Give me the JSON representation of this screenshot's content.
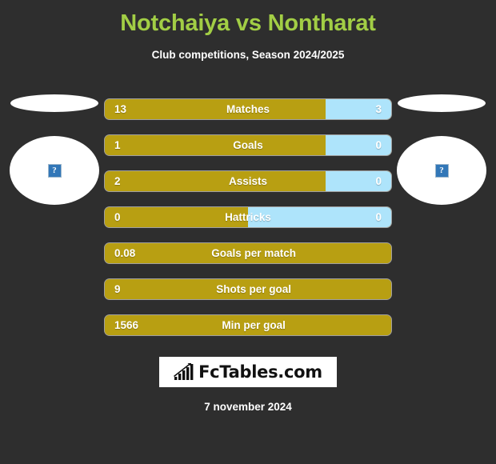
{
  "header": {
    "title": "Notchaiya vs Nontharat",
    "subtitle": "Club competitions, Season 2024/2025",
    "title_color": "#a2ce45"
  },
  "players": {
    "left": {
      "photo_alt_icon": "broken-image-icon",
      "placeholder_glyph": "?"
    },
    "right": {
      "photo_alt_icon": "broken-image-icon",
      "placeholder_glyph": "?"
    }
  },
  "colors": {
    "background": "#2e2e2e",
    "bar_left": "#b89f12",
    "bar_right": "#aee4fb",
    "text": "#ffffff"
  },
  "chart_data": {
    "type": "bar",
    "title": "Notchaiya vs Nontharat",
    "subtitle": "Club competitions, Season 2024/2025",
    "orientation": "horizontal-diverging",
    "series": [
      {
        "name": "Notchaiya",
        "color": "#b89f12",
        "side": "left"
      },
      {
        "name": "Nontharat",
        "color": "#aee4fb",
        "side": "right"
      }
    ],
    "categories": [
      "Matches",
      "Goals",
      "Assists",
      "Hattricks",
      "Goals per match",
      "Shots per goal",
      "Min per goal"
    ],
    "rows": [
      {
        "label": "Matches",
        "left_value": "13",
        "right_value": "3",
        "left_pct": 77,
        "split": true
      },
      {
        "label": "Goals",
        "left_value": "1",
        "right_value": "0",
        "left_pct": 77,
        "split": true
      },
      {
        "label": "Assists",
        "left_value": "2",
        "right_value": "0",
        "left_pct": 77,
        "split": true
      },
      {
        "label": "Hattricks",
        "left_value": "0",
        "right_value": "0",
        "left_pct": 50,
        "split": true
      },
      {
        "label": "Goals per match",
        "left_value": "0.08",
        "right_value": "",
        "left_pct": 100,
        "split": false
      },
      {
        "label": "Shots per goal",
        "left_value": "9",
        "right_value": "",
        "left_pct": 100,
        "split": false
      },
      {
        "label": "Min per goal",
        "left_value": "1566",
        "right_value": "",
        "left_pct": 100,
        "split": false
      }
    ],
    "grid": false,
    "legend": "none"
  },
  "logo": {
    "text": "FcTables.com",
    "icon": "bar-chart-growth-icon"
  },
  "footer": {
    "date": "7 november 2024"
  }
}
